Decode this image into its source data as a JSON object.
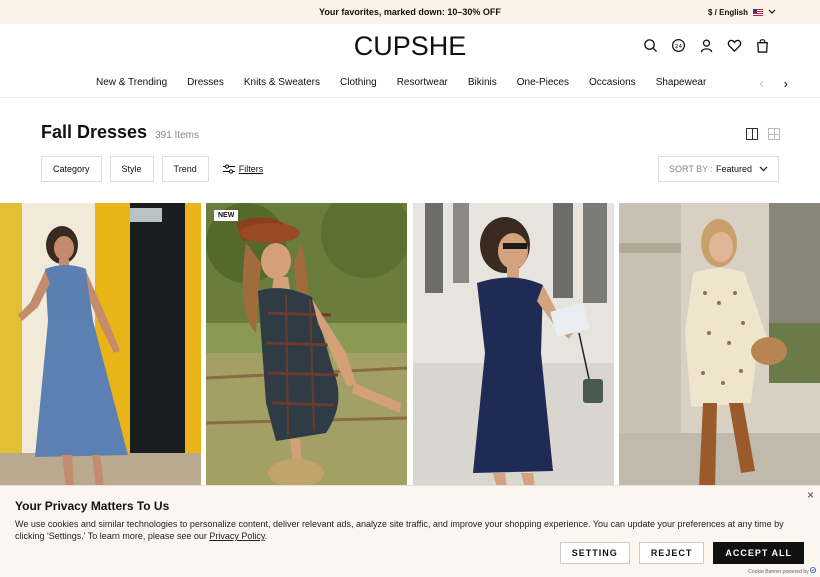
{
  "promo": {
    "text": "Your favorites, marked down: 10–30% OFF",
    "locale": "$ / English"
  },
  "header": {
    "logo": "CUPSHE",
    "icons": [
      "search-icon",
      "points-icon",
      "account-icon",
      "wishlist-icon",
      "cart-icon"
    ]
  },
  "nav": {
    "items": [
      "New & Trending",
      "Dresses",
      "Knits & Sweaters",
      "Clothing",
      "Resortwear",
      "Bikinis",
      "One-Pieces",
      "Occasions",
      "Shapewear"
    ],
    "prev": "‹",
    "next": "›"
  },
  "listing": {
    "title": "Fall Dresses",
    "count": "391 Items",
    "filters": [
      "Category",
      "Style",
      "Trend"
    ],
    "filters_link": "Filters",
    "sort_label": "SORT BY :",
    "sort_value": "Featured"
  },
  "products": [
    {
      "badge": ""
    },
    {
      "badge": "NEW"
    },
    {
      "badge": ""
    },
    {
      "badge": ""
    }
  ],
  "cookie": {
    "title": "Your Privacy Matters To Us",
    "text": "We use cookies and similar technologies to personalize content, deliver relevant ads, analyze site traffic, and improve your shopping experience. You can update your preferences at any time by clicking 'Settings.' To learn more, please see our ",
    "link": "Privacy Policy",
    "text_end": ".",
    "setting": "SETTING",
    "reject": "REJECT",
    "accept": "ACCEPT ALL",
    "powered": "Cookie Banner powered by",
    "close": "×"
  },
  "colors": {
    "promo_bg": "#fbf3e8",
    "cookie_bg": "#fbf7f0",
    "accent": "#111111"
  }
}
